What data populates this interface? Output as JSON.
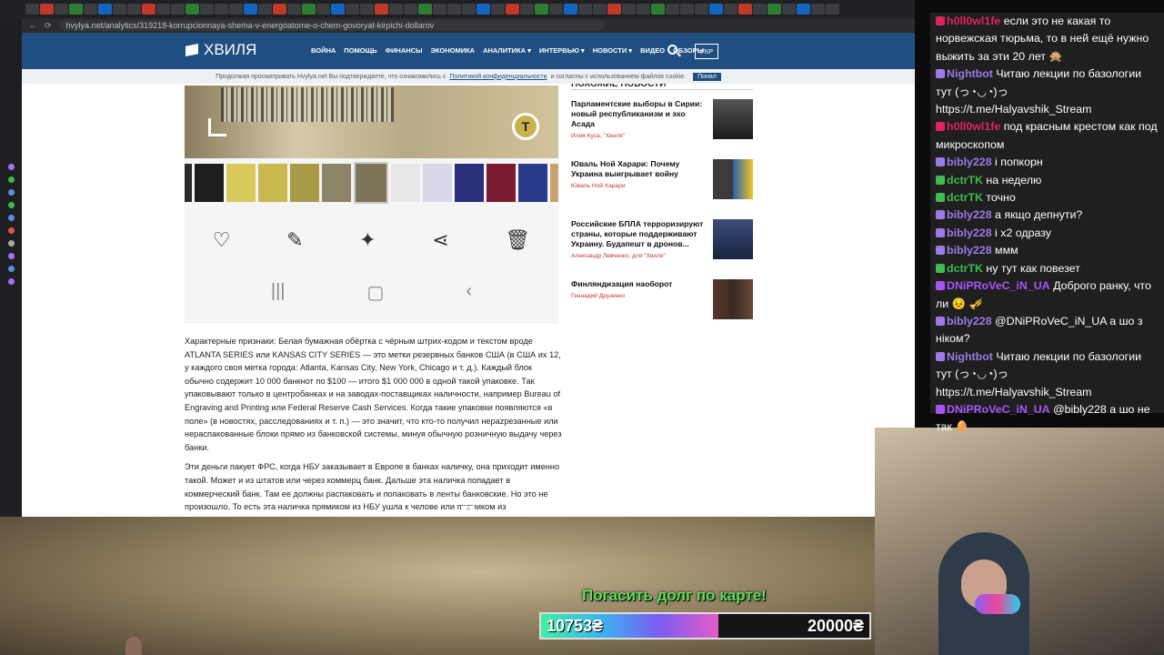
{
  "browser": {
    "url": "hvylya.net/analytics/319218-korrupcionnaya-shema-v-energoatome-o-chem-govoryat-kirpichi-dollarov"
  },
  "site": {
    "logo": "ХВИЛЯ",
    "menu": [
      "ВОЙНА",
      "ПОМОЩЬ",
      "ФИНАНСЫ",
      "ЭКОНОМИКА",
      "АНАЛИТИКА ▾",
      "ИНТЕРВЬЮ ▾",
      "НОВОСТИ ▾",
      "ВИДЕО",
      "ОБЗОРЫ"
    ],
    "lang_button": "УКР",
    "cookie": {
      "text_before": "Продолжая просматривать Hvylya.net Вы подтверждаете, что ознакомились с",
      "link": "Политикой конфиденциальности",
      "text_after": "и согласны с использованием файлов cookie.",
      "button": "Понял"
    }
  },
  "article": {
    "paragraphs": [
      "Характерные признаки: Белая бумажная обёртка с чёрным штрих-кодом и текстом вроде ATLANTA SERIES или KANSAS CITY SERIES — это метки резервных банков США (в США их 12, у каждого своя метка города: Atlanta, Kansas City, New York, Chicago и т. д.). Каждый блок обычно содержит 10 000 банкнот по $100 — итого $1 000 000 в одной такой упаковке. Так упаковывают только в центробанках и на заводах-поставщиках наличности, например Bureau of Engraving and Printing или Federal Reserve Cash Services. Когда такие упаковки появляются «в поле» (в новостях, расследованиях и т. п.) — это значит, что кто-то получил нерazрезанные или нераспакованные блоки прямо из банковской системы, минуя обычную розничную выдачу через банки.",
      "Эти деньги пакует ФРС, когда НБУ заказывает в Европе в банках наличку, она приходит именно такой. Может и из штатов или через коммерц банк. Дальше эта наличка попадает в коммерческий банк. Там ее должны распаковать и попаковать в ленты банковские. Но это не произошло. То есть эта наличка прямиком из НБУ ушла к челове   или прямиком из"
    ]
  },
  "related": {
    "heading": "ПОХОЖИЕ НОВОСТИ",
    "items": [
      {
        "title": "Парламентские выборы в Сирии: новый республиканизм и эхо Асада",
        "author": "Илия Куса, \"Хвиля\""
      },
      {
        "title": "Юваль Ной Харари: Почему Украина выигрывает войну",
        "author": "Юваль Ной Харари"
      },
      {
        "title": "Российские БПЛА терроризируют страны, которые поддерживают Украину. Будапешт в дронов...",
        "author": "Александр Левченко, для \"Хвиля\""
      },
      {
        "title": "Финляндизация наоборот",
        "author": "Геннадий Друзенко"
      }
    ]
  },
  "chat": [
    {
      "user": "h0ll0wl1fe",
      "color": "#e0245e",
      "text": "если это не какая то норвежская тюрьма, то в ней ещё нужно выжить за эти 20 лет 🙊"
    },
    {
      "user": "Nightbot",
      "color": "#9b7be8",
      "text": "Читаю лекции по базологии тут (っ◔◡◔)っ https://t.me/Halyavshik_Stream"
    },
    {
      "user": "h0ll0wl1fe",
      "color": "#e0245e",
      "text": "под красным крестом как под микроскопом"
    },
    {
      "user": "bibly228",
      "color": "#9b7be8",
      "text": "і попкорн"
    },
    {
      "user": "dctrTK",
      "color": "#3fb950",
      "text": "на неделю"
    },
    {
      "user": "dctrTK",
      "color": "#3fb950",
      "text": "точно"
    },
    {
      "user": "bibly228",
      "color": "#9b7be8",
      "text": "а якщо депнути?"
    },
    {
      "user": "bibly228",
      "color": "#9b7be8",
      "text": "і х2 одразу"
    },
    {
      "user": "bibly228",
      "color": "#9b7be8",
      "text": "ммм"
    },
    {
      "user": "dctrTK",
      "color": "#3fb950",
      "text": "ну тут как повезет"
    },
    {
      "user": "DNiPRoVeC_iN_UA",
      "color": "#a855f7",
      "text": "Доброго ранку, что ли 😣 🎺"
    },
    {
      "user": "bibly228",
      "color": "#9b7be8",
      "text": "@DNiPRoVeC_iN_UA а шо з ніком?"
    },
    {
      "user": "Nightbot",
      "color": "#9b7be8",
      "text": "Читаю лекции по базологии тут (っ◔◡◔)っ https://t.me/Halyavshik_Stream"
    },
    {
      "user": "DNiPRoVeC_iN_UA",
      "color": "#a855f7",
      "text": "@bibly228 а шо не так 🥚"
    }
  ],
  "donation": {
    "title": "Погасить долг по карте!",
    "current": "10753₴",
    "goal": "20000₴",
    "progress": 0.54
  },
  "colors": {
    "nav": "#1f4f80",
    "accent_red": "#c0392b",
    "donation_green": "#5ae05a"
  }
}
